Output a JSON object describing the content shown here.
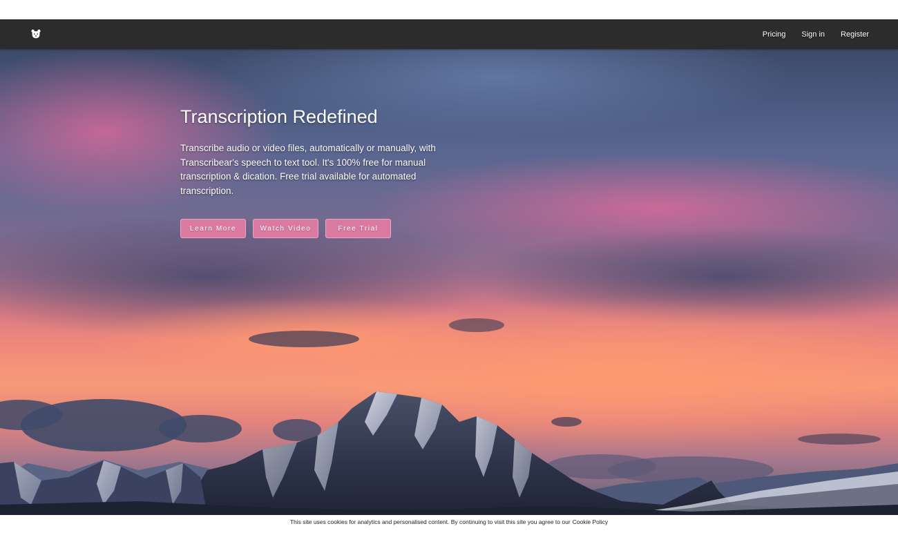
{
  "nav": {
    "logo_icon": "bear-icon",
    "links": [
      {
        "label": "Pricing"
      },
      {
        "label": "Sign in"
      },
      {
        "label": "Register"
      }
    ]
  },
  "hero": {
    "title": "Transcription Redefined",
    "description": "Transcribe audio or video files, automatically or manually, with Transcribear's speech to text tool. It's 100% free for manual transcription & dication. Free trial available for automated transcription.",
    "buttons": {
      "learn_more": "Learn More",
      "watch_video": "Watch Video",
      "free_trial": "Free Trial"
    },
    "button_color": "#db7aa0",
    "background_image": "mountain-sunset-icon"
  },
  "cookie": {
    "text": "This site uses cookies for analytics and personalised content. By continuing to visit this site you agree to our",
    "link": "Cookie Policy"
  }
}
